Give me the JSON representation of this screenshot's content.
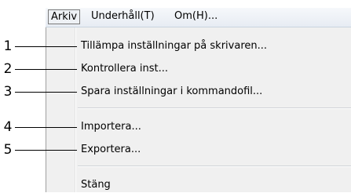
{
  "menubar": {
    "menus": [
      "Arkiv",
      "Underhåll(T)",
      "Om(H)..."
    ]
  },
  "dropdown": {
    "items": [
      "Tillämpa inställningar på skrivaren...",
      "Kontrollera inst...",
      "Spara inställningar i kommandofil...",
      "Importera...",
      "Exportera...",
      "Stäng"
    ]
  },
  "callouts": [
    "1",
    "2",
    "3",
    "4",
    "5"
  ]
}
